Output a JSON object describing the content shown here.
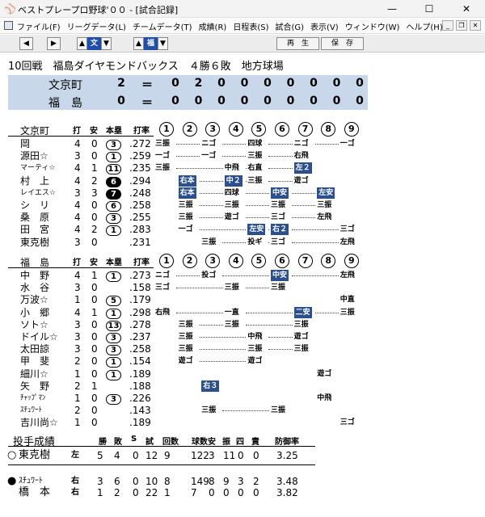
{
  "window": {
    "title": "ベストプレープロ野球'００ - [試合記録]",
    "minimize": "—",
    "maximize": "☐",
    "close": "✕"
  },
  "menu": [
    "ファイル(F)",
    "リーグデータ(L)",
    "チームデータ(T)",
    "成績(R)",
    "日程表(S)",
    "試合(G)",
    "表示(V)",
    "ウィンドウ(W)",
    "ヘルプ(H)"
  ],
  "toolbar": {
    "team1": "文",
    "team2": "福",
    "replay": "再　生",
    "save": "保　存"
  },
  "game": {
    "header": "10回戦　福島ダイヤモンドバックス　４勝６敗　地方球場"
  },
  "scoreboard": [
    {
      "team": "文京町",
      "total": "2",
      "innings": [
        "0",
        "2",
        "0",
        "0",
        "0",
        "0",
        "0",
        "0",
        "0"
      ]
    },
    {
      "team": "福　島",
      "total": "0",
      "innings": [
        "0",
        "0",
        "0",
        "0",
        "0",
        "0",
        "0",
        "0",
        "0"
      ]
    }
  ],
  "box_headers": {
    "da": "打",
    "an": "安",
    "hr": "本塁",
    "avg": "打率"
  },
  "inning_labels": [
    "1",
    "2",
    "3",
    "4",
    "5",
    "6",
    "7",
    "8",
    "9"
  ],
  "team1": {
    "name": "文京町",
    "players": [
      {
        "name": "岡",
        "ab": "4",
        "h": "0",
        "hr": "3",
        "hr_filled": false,
        "avg": ".272",
        "res": [
          {
            "i": 1,
            "t": "三振"
          },
          {
            "i": 3,
            "t": "ニゴ"
          },
          {
            "i": 5,
            "t": "四球"
          },
          {
            "i": 7,
            "t": "ニゴ"
          },
          {
            "i": 9,
            "t": "一ゴ"
          }
        ]
      },
      {
        "name": "源田☆",
        "ab": "3",
        "h": "0",
        "hr": "1",
        "hr_filled": false,
        "avg": ".259",
        "res": [
          {
            "i": 1,
            "t": "一ゴ"
          },
          {
            "i": 3,
            "t": "一ゴ"
          },
          {
            "i": 5,
            "t": "三振"
          },
          {
            "i": 7,
            "t": "右飛"
          }
        ]
      },
      {
        "name": "マーティ☆",
        "ab": "4",
        "h": "1",
        "hr": "11",
        "hr_filled": false,
        "avg": ".235",
        "res": [
          {
            "i": 1,
            "t": "三振"
          },
          {
            "i": 4,
            "t": "中飛"
          },
          {
            "i": 5,
            "t": "右直"
          },
          {
            "i": 7,
            "t": "左２",
            "hi": true
          }
        ]
      },
      {
        "name": "村　上",
        "ab": "4",
        "h": "2",
        "hr": "6",
        "hr_filled": true,
        "avg": ".294",
        "res": [
          {
            "i": 2,
            "t": "右本",
            "hi": true
          },
          {
            "i": 4,
            "t": "中２",
            "hi": true
          },
          {
            "i": 5,
            "t": "三振"
          },
          {
            "i": 7,
            "t": "遊ゴ"
          }
        ]
      },
      {
        "name": "レイエス☆",
        "ab": "3",
        "h": "3",
        "hr": "7",
        "hr_filled": true,
        "avg": ".248",
        "res": [
          {
            "i": 2,
            "t": "右本",
            "hi": true
          },
          {
            "i": 4,
            "t": "四球"
          },
          {
            "i": 6,
            "t": "中安",
            "hi": true
          },
          {
            "i": 8,
            "t": "左安",
            "hi": true
          }
        ]
      },
      {
        "name": "シ　リ",
        "ab": "4",
        "h": "0",
        "hr": "6",
        "hr_filled": false,
        "avg": ".258",
        "res": [
          {
            "i": 2,
            "t": "三振"
          },
          {
            "i": 4,
            "t": "三振"
          },
          {
            "i": 6,
            "t": "三振"
          },
          {
            "i": 8,
            "t": "三振"
          }
        ]
      },
      {
        "name": "桑　原",
        "ab": "4",
        "h": "0",
        "hr": "3",
        "hr_filled": false,
        "avg": ".255",
        "res": [
          {
            "i": 2,
            "t": "三振"
          },
          {
            "i": 4,
            "t": "遊ゴ"
          },
          {
            "i": 6,
            "t": "三ゴ"
          },
          {
            "i": 8,
            "t": "左飛"
          }
        ]
      },
      {
        "name": "田　宮",
        "ab": "4",
        "h": "2",
        "hr": "1",
        "hr_filled": false,
        "avg": ".283",
        "res": [
          {
            "i": 2,
            "t": "一ゴ"
          },
          {
            "i": 5,
            "t": "左安",
            "hi": true
          },
          {
            "i": 6,
            "t": "右２",
            "hi": true
          },
          {
            "i": 9,
            "t": "三ゴ"
          }
        ]
      },
      {
        "name": "東克樹",
        "ab": "3",
        "h": "0",
        "hr": "",
        "hr_filled": false,
        "avg": ".231",
        "res": [
          {
            "i": 3,
            "t": "三振"
          },
          {
            "i": 5,
            "t": "投ギ"
          },
          {
            "i": 6,
            "t": "三ゴ"
          },
          {
            "i": 9,
            "t": "左飛"
          }
        ]
      }
    ]
  },
  "team2": {
    "name": "福　島",
    "players": [
      {
        "name": "中　野",
        "ab": "4",
        "h": "1",
        "hr": "1",
        "hr_filled": false,
        "avg": ".273",
        "res": [
          {
            "i": 1,
            "t": "ニゴ"
          },
          {
            "i": 3,
            "t": "投ゴ"
          },
          {
            "i": 6,
            "t": "中安",
            "hi": true
          },
          {
            "i": 9,
            "t": "左飛"
          }
        ]
      },
      {
        "name": "水　谷",
        "ab": "3",
        "h": "0",
        "hr": "",
        "hr_filled": false,
        "avg": ".158",
        "res": [
          {
            "i": 1,
            "t": "三ゴ"
          },
          {
            "i": 4,
            "t": "三振"
          },
          {
            "i": 6,
            "t": "三振"
          }
        ]
      },
      {
        "name": "万波☆",
        "ab": "1",
        "h": "0",
        "hr": "5",
        "hr_filled": false,
        "avg": ".179",
        "res": [
          {
            "i": 9,
            "t": "中直"
          }
        ]
      },
      {
        "name": "小　郷",
        "ab": "4",
        "h": "1",
        "hr": "1",
        "hr_filled": false,
        "avg": ".298",
        "res": [
          {
            "i": 1,
            "t": "右飛"
          },
          {
            "i": 4,
            "t": "一直"
          },
          {
            "i": 7,
            "t": "二安",
            "hi": true
          },
          {
            "i": 9,
            "t": "三振"
          }
        ]
      },
      {
        "name": "ソト☆",
        "ab": "3",
        "h": "0",
        "hr": "13",
        "hr_filled": false,
        "avg": ".278",
        "res": [
          {
            "i": 2,
            "t": "三振"
          },
          {
            "i": 4,
            "t": "三振"
          },
          {
            "i": 7,
            "t": "三振"
          }
        ]
      },
      {
        "name": "ドイル☆",
        "ab": "3",
        "h": "0",
        "hr": "3",
        "hr_filled": false,
        "avg": ".237",
        "res": [
          {
            "i": 2,
            "t": "三振"
          },
          {
            "i": 5,
            "t": "中飛"
          },
          {
            "i": 7,
            "t": "遊ゴ"
          }
        ]
      },
      {
        "name": "太田諒",
        "ab": "3",
        "h": "0",
        "hr": "3",
        "hr_filled": false,
        "avg": ".258",
        "res": [
          {
            "i": 2,
            "t": "三振"
          },
          {
            "i": 5,
            "t": "三振"
          },
          {
            "i": 7,
            "t": "三振"
          }
        ]
      },
      {
        "name": "甲　斐",
        "ab": "2",
        "h": "0",
        "hr": "1",
        "hr_filled": false,
        "avg": ".154",
        "res": [
          {
            "i": 2,
            "t": "遊ゴ"
          },
          {
            "i": 5,
            "t": "遊ゴ"
          }
        ]
      },
      {
        "name": "細川☆",
        "ab": "1",
        "h": "0",
        "hr": "1",
        "hr_filled": false,
        "avg": ".189",
        "res": [
          {
            "i": 8,
            "t": "遊ゴ"
          }
        ]
      },
      {
        "name": "矢　野",
        "ab": "2",
        "h": "1",
        "hr": "",
        "hr_filled": false,
        "avg": ".188",
        "res": [
          {
            "i": 3,
            "t": "右３",
            "hi": true
          }
        ]
      },
      {
        "name": "ﾁｬｯﾌﾟﾏﾝ",
        "ab": "1",
        "h": "0",
        "hr": "3",
        "hr_filled": false,
        "avg": ".226",
        "res": [
          {
            "i": 8,
            "t": "中飛"
          }
        ]
      },
      {
        "name": "ｽﾁｭﾜｰﾄ",
        "ab": "2",
        "h": "0",
        "hr": "",
        "hr_filled": false,
        "avg": ".143",
        "res": [
          {
            "i": 3,
            "t": "三振"
          },
          {
            "i": 6,
            "t": "三振"
          }
        ]
      },
      {
        "name": "吉川尚☆",
        "ab": "1",
        "h": "0",
        "hr": "",
        "hr_filled": false,
        "avg": ".189",
        "res": [
          {
            "i": 9,
            "t": "三ゴ"
          }
        ]
      }
    ]
  },
  "pitching": {
    "title": "投手成績",
    "headers": [
      "勝",
      "敗",
      "S",
      "試",
      "回数",
      "球数",
      "安",
      "振",
      "四",
      "責",
      "防御率"
    ],
    "rows": [
      {
        "mark": "○",
        "name": "東克樹",
        "hand": "左",
        "vals": [
          "5",
          "4",
          "0",
          "12",
          "9",
          "122",
          "3",
          "11",
          "0",
          "0",
          "3.25"
        ]
      },
      {
        "mark": "●",
        "name": "ｽﾁｭﾜｰﾄ",
        "hand": "右",
        "vals": [
          "3",
          "6",
          "0",
          "10",
          "8",
          "149",
          "8",
          "9",
          "3",
          "2",
          "3.48"
        ]
      },
      {
        "mark": "",
        "name": "橋　本",
        "hand": "右",
        "vals": [
          "1",
          "2",
          "0",
          "22",
          "1",
          "7",
          "0",
          "0",
          "0",
          "0",
          "3.82"
        ]
      }
    ]
  }
}
